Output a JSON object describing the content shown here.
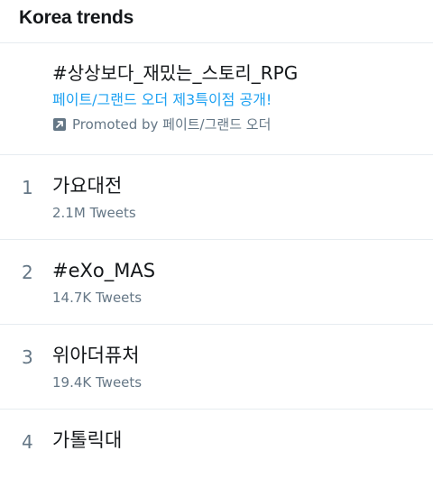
{
  "header": {
    "title": "Korea trends"
  },
  "promoted": {
    "hashtag": "#상상보다_재밌는_스토리_RPG",
    "description": "페이트/그랜드 오더 제3특이점 공개!",
    "promoted_label": "Promoted by 페이트/그랜드 오더",
    "icon": "promoted-arrow-icon"
  },
  "trends": [
    {
      "rank": "1",
      "name": "가요대전",
      "count": "2.1M Tweets"
    },
    {
      "rank": "2",
      "name": "#eXo_MAS",
      "count": "14.7K Tweets"
    },
    {
      "rank": "3",
      "name": "위아더퓨처",
      "count": "19.4K Tweets"
    },
    {
      "rank": "4",
      "name": "가톨릭대",
      "count": ""
    }
  ],
  "colors": {
    "link": "#1da1f2",
    "secondary_text": "#657786",
    "primary_text": "#14171a",
    "divider": "#e6ecf0"
  }
}
